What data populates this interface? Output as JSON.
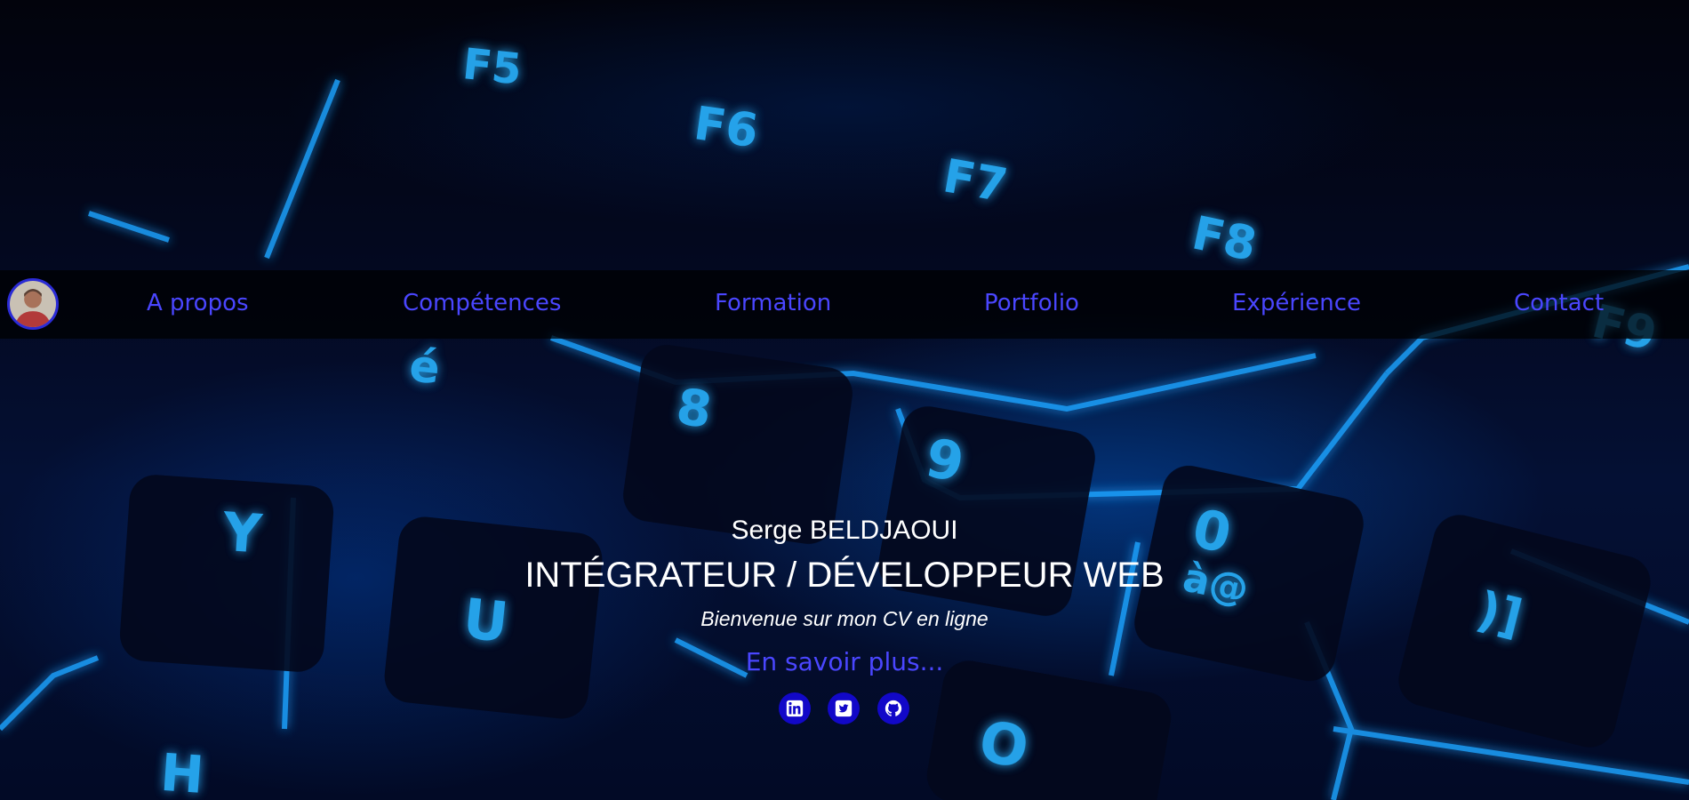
{
  "nav": {
    "items": [
      {
        "label": "A propos"
      },
      {
        "label": "Compétences"
      },
      {
        "label": "Formation"
      },
      {
        "label": "Portfolio"
      },
      {
        "label": "Expérience"
      },
      {
        "label": "Contact"
      }
    ]
  },
  "hero": {
    "name": "Serge BELDJAOUI",
    "title": "INTÉGRATEUR / DÉVELOPPEUR WEB",
    "subtitle": "Bienvenue sur mon CV en ligne",
    "more_link": "En savoir plus..."
  },
  "social": [
    {
      "icon": "linkedin-icon"
    },
    {
      "icon": "twitter-icon"
    },
    {
      "icon": "github-icon"
    }
  ],
  "colors": {
    "nav_link": "#4a46ff",
    "social_bg": "#1208c8",
    "hero_text": "#ffffff"
  }
}
